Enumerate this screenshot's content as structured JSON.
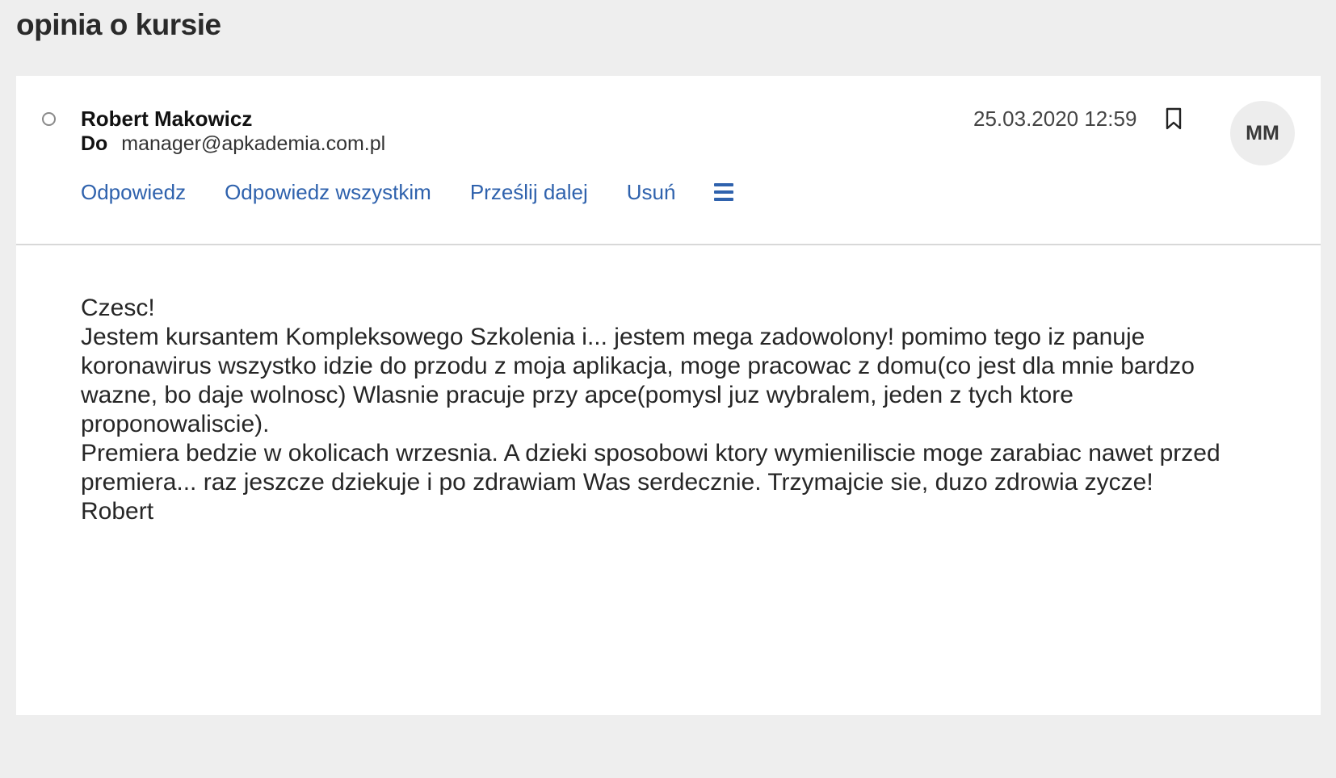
{
  "page": {
    "title": "opinia o kursie"
  },
  "message": {
    "sender": "Robert Makowicz",
    "recipient_label": "Do",
    "recipient": "manager@apkademia.com.pl",
    "date": "25.03.2020 12:59",
    "avatar_initials": "MM"
  },
  "actions": {
    "reply": "Odpowiedz",
    "reply_all": "Odpowiedz wszystkim",
    "forward": "Prześlij dalej",
    "delete": "Usuń",
    "menu_icon": "hamburger-menu-icon"
  },
  "icons": {
    "read_status": "circle-icon",
    "bookmark": "bookmark-icon"
  },
  "body": {
    "greeting": "Czesc!",
    "paragraphs": [
      "Jestem kursantem Kompleksowego Szkolenia i... jestem mega zadowolony! pomimo tego iz panuje koronawirus wszystko idzie do przodu z moja aplikacja, moge pracowac z domu(co jest dla mnie bardzo wazne, bo daje wolnosc) Wlasnie pracuje przy apce(pomysl juz wybralem, jeden z tych ktore proponowaliscie).",
      "Premiera bedzie w okolicach wrzesnia. A dzieki sposobowi ktory wymieniliscie moge zarabiac nawet przed premiera... raz jeszcze dziekuje i po zdrawiam Was serdecznie. Trzymajcie sie, duzo zdrowia zycze!"
    ],
    "signature": "Robert"
  },
  "colors": {
    "page_background": "#eeeeee",
    "card_background": "#ffffff",
    "link": "#2f62ad",
    "avatar_background": "#ededed"
  }
}
